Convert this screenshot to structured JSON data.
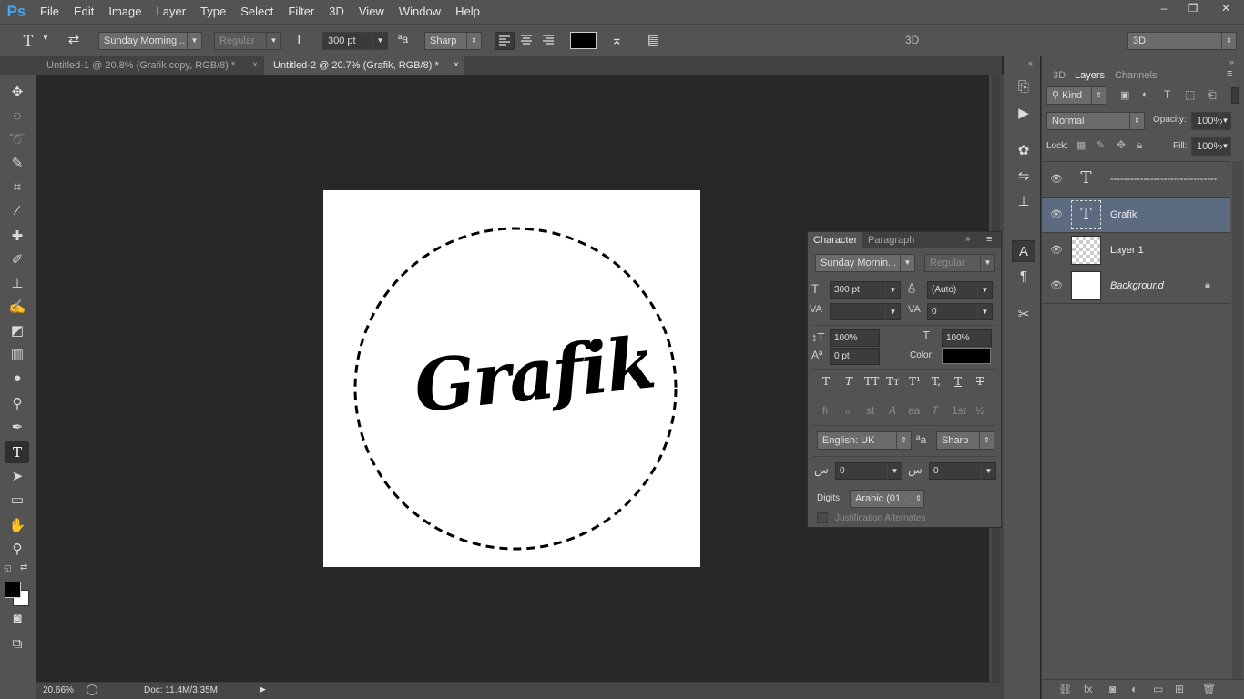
{
  "app": {
    "logo": "Ps"
  },
  "menu": [
    "File",
    "Edit",
    "Image",
    "Layer",
    "Type",
    "Select",
    "Filter",
    "3D",
    "View",
    "Window",
    "Help"
  ],
  "window_controls": {
    "minimize": "–",
    "restore": "❐",
    "close": "✕"
  },
  "options_bar": {
    "tool_icon": "T",
    "font_family": "Sunday Morning...",
    "font_style": "Regular",
    "font_size": "300 pt",
    "aa_icon": "ªa",
    "antialias": "Sharp",
    "color": "#000000",
    "center_label": "3D",
    "workspace": "3D"
  },
  "tabs": [
    {
      "label": "Untitled-1 @ 20.8% (Grafik copy, RGB/8) *",
      "close": "×"
    },
    {
      "label": "Untitled-2 @ 20.7% (Grafik, RGB/8) *",
      "close": "×"
    }
  ],
  "canvas": {
    "text": "Grafik"
  },
  "status": {
    "zoom": "20.66%",
    "doc": "Doc: 11.4M/3.35M"
  },
  "layers_panel": {
    "tabs": [
      "3D",
      "Layers",
      "Channels"
    ],
    "filter_kind": "Kind",
    "blend_mode": "Normal",
    "opacity_label": "Opacity:",
    "opacity": "100%",
    "lock_label": "Lock:",
    "fill_label": "Fill:",
    "fill": "100%",
    "layers": [
      {
        "name": "--------------------------------",
        "type": "text"
      },
      {
        "name": "Grafik",
        "type": "text"
      },
      {
        "name": "Layer 1",
        "type": "pixel"
      },
      {
        "name": "Background",
        "type": "background"
      }
    ]
  },
  "character_panel": {
    "tabs": [
      "Character",
      "Paragraph"
    ],
    "font_family": "Sunday Mornin...",
    "font_style": "Regular",
    "font_size": "300 pt",
    "leading": "(Auto)",
    "kerning": "",
    "tracking": "0",
    "vertical_scale": "100%",
    "horizontal_scale": "100%",
    "baseline_shift": "0 pt",
    "color_label": "Color:",
    "color": "#000000",
    "style_glyphs": [
      "T",
      "T",
      "TT",
      "Tт",
      "T¹",
      "T,",
      "T",
      "T"
    ],
    "opentype_glyphs": [
      "fi",
      "ℴ",
      "st",
      "A",
      "aa",
      "T",
      "1st",
      "½"
    ],
    "language": "English: UK",
    "aa_icon": "ªa",
    "antialias": "Sharp",
    "arabic_a": "0",
    "arabic_b": "0",
    "digits_label": "Digits:",
    "digits": "Arabic (01...",
    "justification_alternates": "Justification Alternates"
  }
}
